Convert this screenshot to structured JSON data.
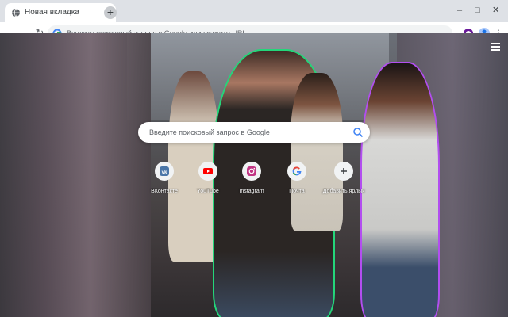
{
  "tab": {
    "title": "Новая вкладка",
    "close": "×"
  },
  "newtab": "+",
  "window": {
    "minimize": "–",
    "maximize": "□",
    "close": "✕"
  },
  "toolbar": {
    "back": "←",
    "forward": "→",
    "reload": "↻"
  },
  "omnibox": {
    "placeholder": "Введите поисковый запрос в Google или укажите URL"
  },
  "search": {
    "placeholder": "Введите поисковый запрос в Google"
  },
  "shortcuts": [
    {
      "label": "ВКонтакте",
      "icon": "vk-icon",
      "color": "#4a76a8"
    },
    {
      "label": "YouTube",
      "icon": "youtube-icon",
      "color": "#ff0000"
    },
    {
      "label": "Instagram",
      "icon": "instagram-icon",
      "color": "#c13584"
    },
    {
      "label": "Почта",
      "icon": "google-icon",
      "color": "#4285f4"
    },
    {
      "label": "Добавить ярлык",
      "icon": "add-icon",
      "color": "#5f6368"
    }
  ],
  "colors": {
    "accent": "#1a73e8",
    "tabstrip": "#dee1e6"
  }
}
